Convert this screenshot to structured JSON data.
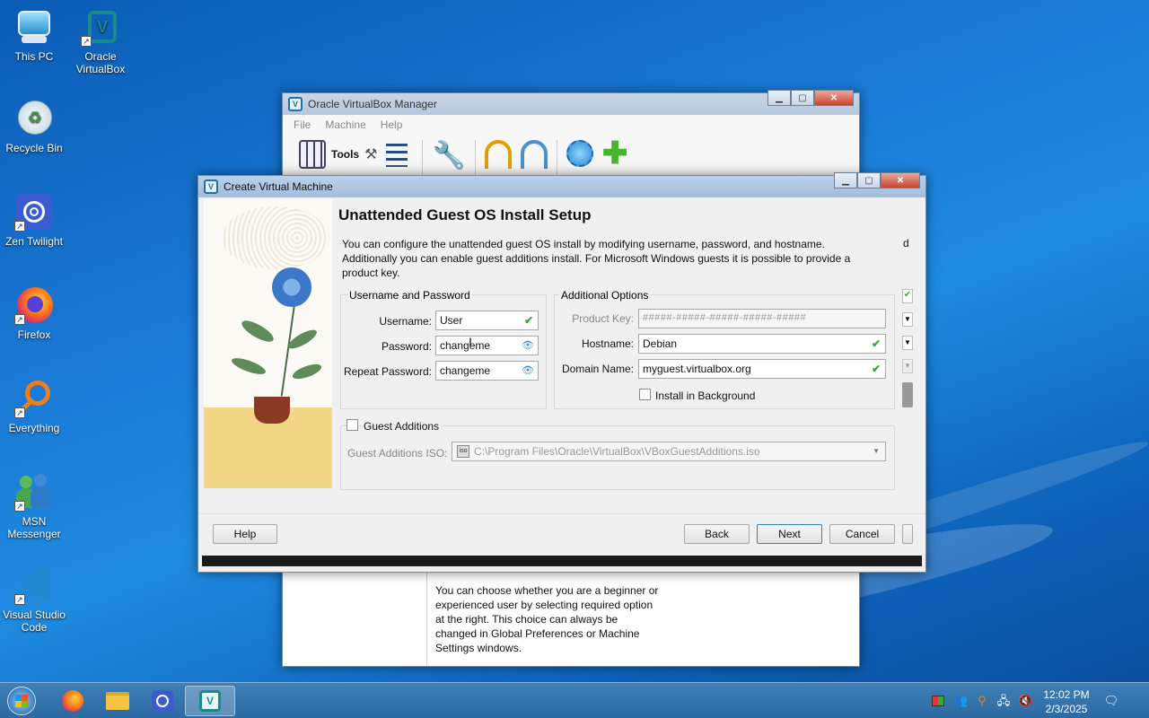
{
  "desktop": {
    "icons": [
      {
        "label_line1": "This PC",
        "label_line2": ""
      },
      {
        "label_line1": "Oracle",
        "label_line2": "VirtualBox"
      },
      {
        "label_line1": "Recycle Bin",
        "label_line2": ""
      },
      {
        "label_line1": "Zen Twilight",
        "label_line2": ""
      },
      {
        "label_line1": "Firefox",
        "label_line2": ""
      },
      {
        "label_line1": "Everything",
        "label_line2": ""
      },
      {
        "label_line1": "MSN",
        "label_line2": "Messenger"
      },
      {
        "label_line1": "Visual Studio",
        "label_line2": "Code"
      }
    ]
  },
  "manager": {
    "title": "Oracle VirtualBox Manager",
    "menu": [
      "File",
      "Machine",
      "Help"
    ],
    "tools_label": "Tools",
    "welcome_text_lines": [
      "You can choose whether you are a beginner or",
      "experienced user by selecting required option",
      "at the right. This choice can always be",
      "changed in Global Preferences or Machine",
      "Settings windows."
    ]
  },
  "dialog": {
    "title": "Create Virtual Machine",
    "heading": "Unattended Guest OS Install Setup",
    "description_lines": [
      "You can configure the unattended guest OS install by modifying username, password, and hostname.",
      "Additionally you can enable guest additions install. For Microsoft Windows guests it is possible to provide a",
      "product key."
    ],
    "cut_off_char": "d",
    "username_group": {
      "title": "Username and Password",
      "username_label": "Username:",
      "username_value": "User",
      "password_label": "Password:",
      "password_value": "changeme",
      "repeat_label": "Repeat Password:",
      "repeat_value": "changeme"
    },
    "additional": {
      "title": "Additional Options",
      "product_key_label": "Product Key:",
      "product_key_placeholder": "#####-#####-#####-#####-#####",
      "hostname_label": "Hostname:",
      "hostname_value": "Debian",
      "domain_label": "Domain Name:",
      "domain_value": "myguest.virtualbox.org",
      "install_bg_label": "Install in Background"
    },
    "guest_additions": {
      "label": "Guest Additions",
      "iso_label": "Guest Additions ISO:",
      "iso_value": "C:\\Program Files\\Oracle\\VirtualBox\\VBoxGuestAdditions.iso"
    },
    "buttons": {
      "help": "Help",
      "back": "Back",
      "next": "Next",
      "cancel": "Cancel"
    }
  },
  "taskbar": {
    "time": "12:02 PM",
    "date": "2/3/2025"
  },
  "colors": {
    "desktop": "#1a7ad6",
    "taskbar": "#2b6aa2",
    "valid_check": "#3ea33e"
  }
}
